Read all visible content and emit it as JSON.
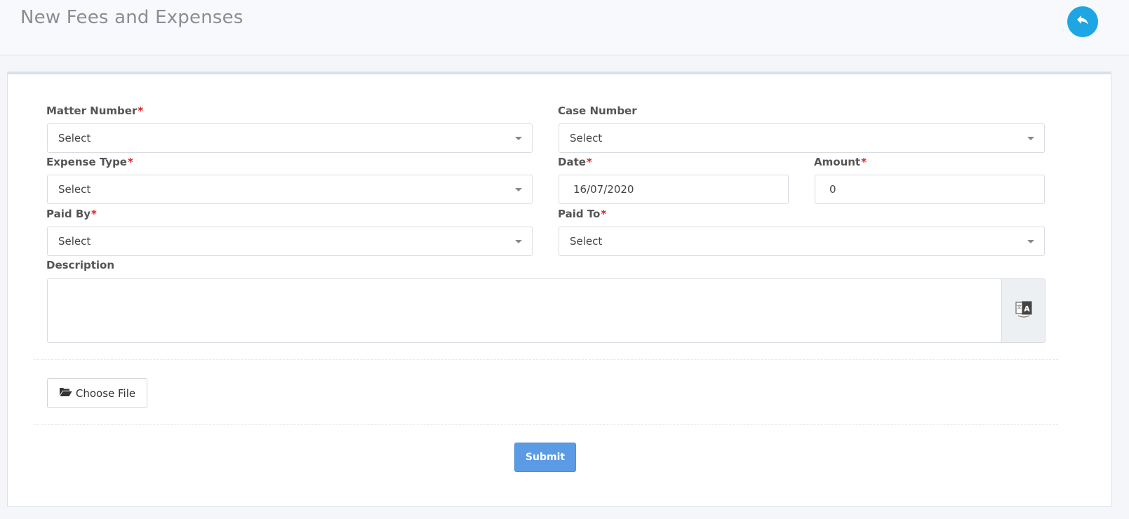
{
  "header": {
    "title": "New Fees and Expenses",
    "back_icon": "reply-arrow-icon",
    "accent": "#1ea5e3"
  },
  "form": {
    "required_marker": "*",
    "matter_number": {
      "label": "Matter Number",
      "value": "Select"
    },
    "case_number": {
      "label": "Case Number",
      "value": "Select"
    },
    "expense_type": {
      "label": "Expense Type",
      "value": "Select"
    },
    "date": {
      "label": "Date",
      "value": "16/07/2020"
    },
    "amount": {
      "label": "Amount",
      "value": "0"
    },
    "paid_by": {
      "label": "Paid By",
      "value": "Select"
    },
    "paid_to": {
      "label": "Paid To",
      "value": "Select"
    },
    "description": {
      "label": "Description",
      "value": "",
      "addon_icon": "translate-icon"
    },
    "choose_file_label": "Choose File",
    "choose_file_icon": "folder-open-icon",
    "submit_label": "Submit"
  }
}
